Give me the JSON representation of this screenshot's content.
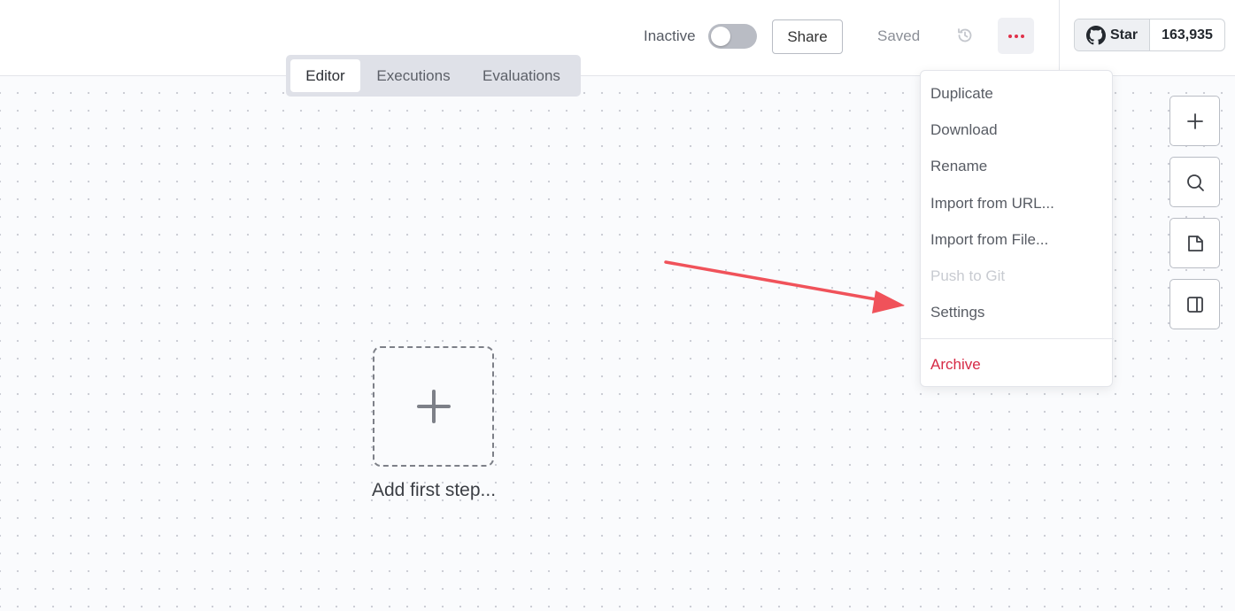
{
  "header": {
    "status_label": "Inactive",
    "share_label": "Share",
    "saved_label": "Saved",
    "github": {
      "star_label": "Star",
      "star_count": "163,935"
    }
  },
  "tabs": [
    {
      "label": "Editor",
      "active": true
    },
    {
      "label": "Executions",
      "active": false
    },
    {
      "label": "Evaluations",
      "active": false
    }
  ],
  "canvas": {
    "add_step_label": "Add first step..."
  },
  "menu": {
    "items": [
      {
        "label": "Duplicate"
      },
      {
        "label": "Download"
      },
      {
        "label": "Rename"
      },
      {
        "label": "Import from URL..."
      },
      {
        "label": "Import from File..."
      },
      {
        "label": "Push to Git",
        "disabled": true
      },
      {
        "label": "Settings"
      }
    ],
    "archive_label": "Archive"
  },
  "tools": [
    "plus-icon",
    "search-icon",
    "sticky-note-icon",
    "panel-icon"
  ],
  "colors": {
    "accent_red": "#d62a45",
    "annotation_arrow": "#f0525a"
  }
}
